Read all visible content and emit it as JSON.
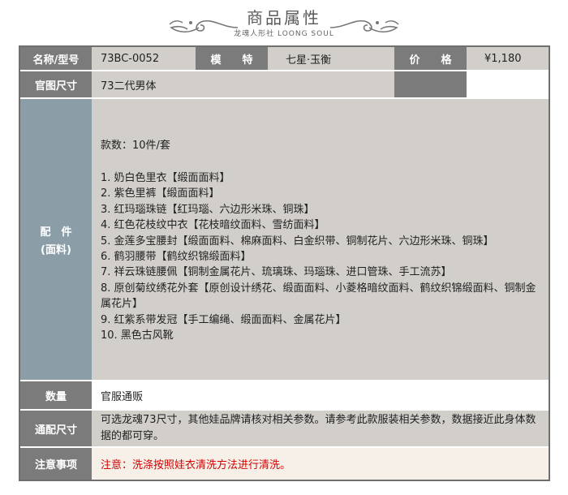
{
  "header": {
    "title": "商品属性",
    "brand": "龙魂人形社 LOONG SOUL"
  },
  "row1": {
    "name_label": "名称/型号",
    "name_value": "73BC-0052",
    "model_label": "模　　特",
    "model_value": "七星·玉衡",
    "price_label": "价　　格",
    "price_value": "¥1,180"
  },
  "row2": {
    "label": "官图尺寸",
    "value": "73二代男体"
  },
  "parts": {
    "label_line1": "配　件",
    "label_line2": "(面料)",
    "count": "款数：10件/套",
    "items": [
      "1. 奶白色里衣【缎面面料】",
      "2. 紫色里裤【缎面面料】",
      "3. 红玛瑙珠链【红玛瑙、六边形米珠、铜珠】",
      "4. 红色花枝纹中衣【花枝暗纹面料、雪纺面料】",
      "5. 金莲多宝腰封【缎面面料、棉麻面料、白金织带、铜制花片、六边形米珠、铜珠】",
      "6. 鹤羽腰带【鹤纹织锦缎面料】",
      "7. 祥云珠链腰佩【铜制金属花片、琉璃珠、玛瑙珠、进口管珠、手工流苏】",
      "8. 原创菊纹绣花外套【原创设计绣花、缎面面料、小菱格暗纹面料、鹤纹织锦缎面料、铜制金属花片】",
      "9. 红紫系带发冠【手工编绳、缎面面料、金属花片】",
      "10. 黑色古风靴"
    ]
  },
  "quantity": {
    "label": "数量",
    "value": "官服通贩"
  },
  "fit": {
    "label": "通配尺寸",
    "value": "可选龙魂73尺寸，其他娃品牌请核对相关参数。请参考此款服装相关参数，数据接近此身体数据的都可穿。"
  },
  "notice": {
    "label": "注意事项",
    "value": "注意：洗涤按照娃衣清洗方法进行清洗。"
  }
}
